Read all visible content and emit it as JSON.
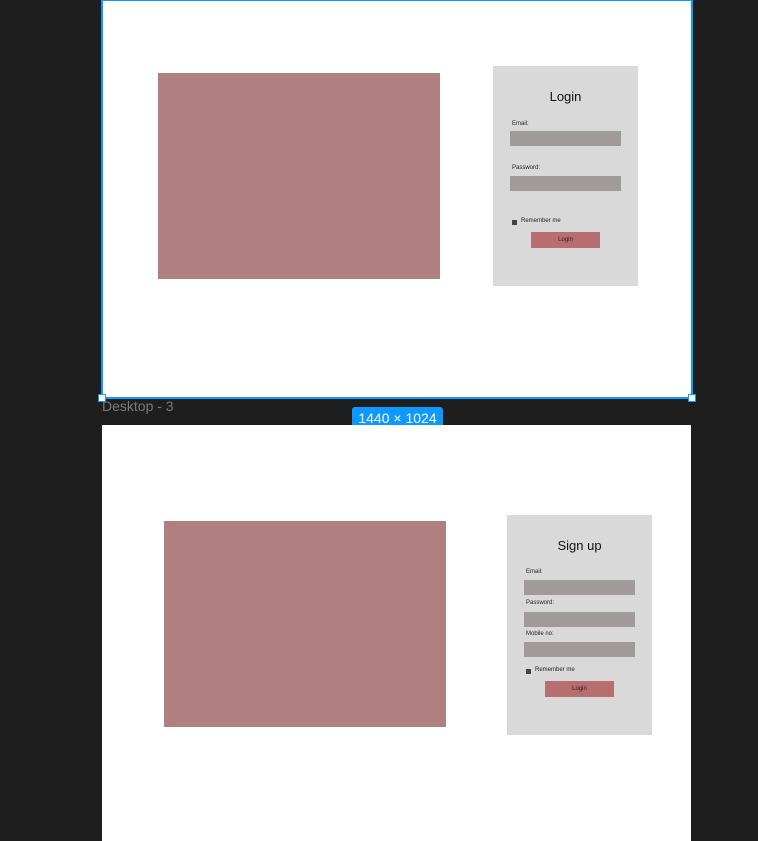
{
  "canvas": {
    "frame_name": "Desktop - 3",
    "frame_size": "1440 × 1024"
  },
  "login_frame": {
    "title": "Login",
    "email_label": "Email:",
    "password_label": "Password:",
    "remember_label": "Remember me",
    "button_label": "Login"
  },
  "signup_frame": {
    "title": "Sign up",
    "email_label": "Email:",
    "password_label": "Password:",
    "mobile_label": "Mobile no:",
    "remember_label": "Remember me",
    "button_label": "Login"
  },
  "colors": {
    "canvas_bg": "#1e1e1e",
    "selection": "#0d99ff",
    "image_placeholder": "#b08080",
    "card_bg": "#d9d9d9",
    "input_bg": "#a19a9a",
    "button_bg": "#b86e6e"
  }
}
